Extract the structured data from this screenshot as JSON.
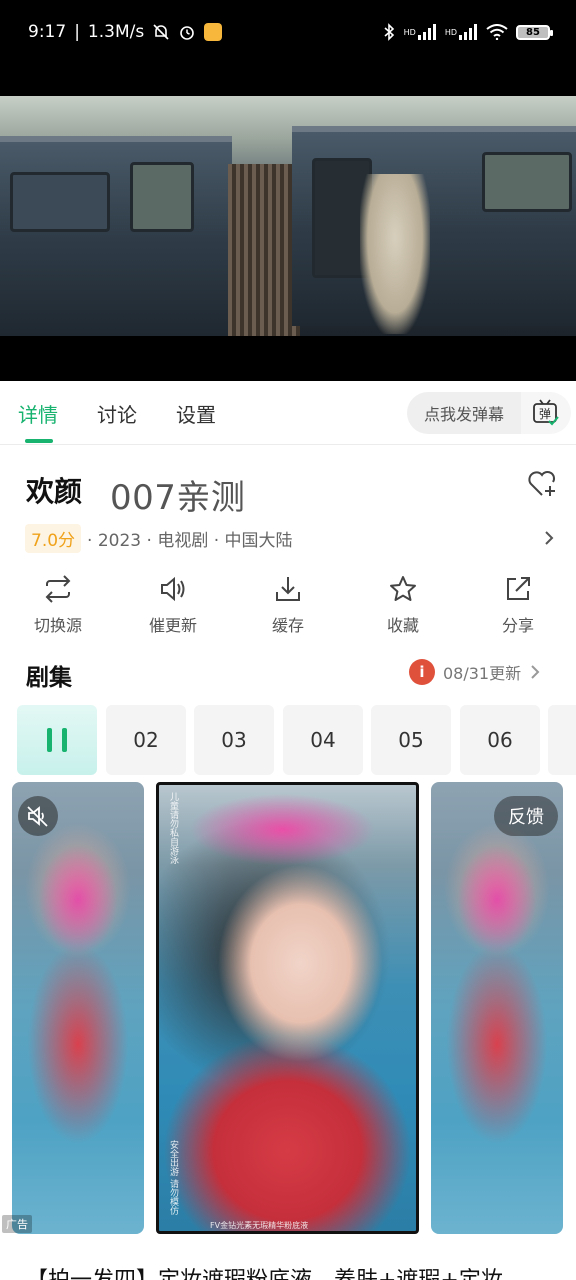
{
  "status_bar": {
    "time": "9:17",
    "speed": "1.3M/s",
    "battery": "85",
    "hd1": "HD",
    "hd2": "HD"
  },
  "tabs": [
    {
      "label": "详情",
      "active": true
    },
    {
      "label": "讨论",
      "active": false
    },
    {
      "label": "设置",
      "active": false
    }
  ],
  "danmu": {
    "placeholder": "点我发弹幕",
    "toggle_icon": "danmu-icon",
    "toggle_glyph": "弹"
  },
  "show": {
    "title": "欢颜",
    "subtitle": "007亲测",
    "score": "7.0分",
    "meta": "· 2023 · 电视剧 · 中国大陆"
  },
  "actions": [
    {
      "label": "切换源",
      "icon": "switch-source-icon"
    },
    {
      "label": "催更新",
      "icon": "speaker-icon"
    },
    {
      "label": "缓存",
      "icon": "download-icon"
    },
    {
      "label": "收藏",
      "icon": "star-icon"
    },
    {
      "label": "分享",
      "icon": "share-icon"
    }
  ],
  "episodes": {
    "title": "剧集",
    "update_icon_glyph": "i",
    "update_text": "08/31更新",
    "items": [
      "",
      "02",
      "03",
      "04",
      "05",
      "06"
    ]
  },
  "ad": {
    "feedback": "反馈",
    "label": "广告",
    "side_text_1": "儿童请勿私自游泳",
    "side_text_2": "安全出游 请勿模仿",
    "caption": "FV金钻光素无瑕精华粉底液",
    "description": "【拍一发四】定妆遮瑕粉底液，养肤+遮瑕+定妆"
  }
}
